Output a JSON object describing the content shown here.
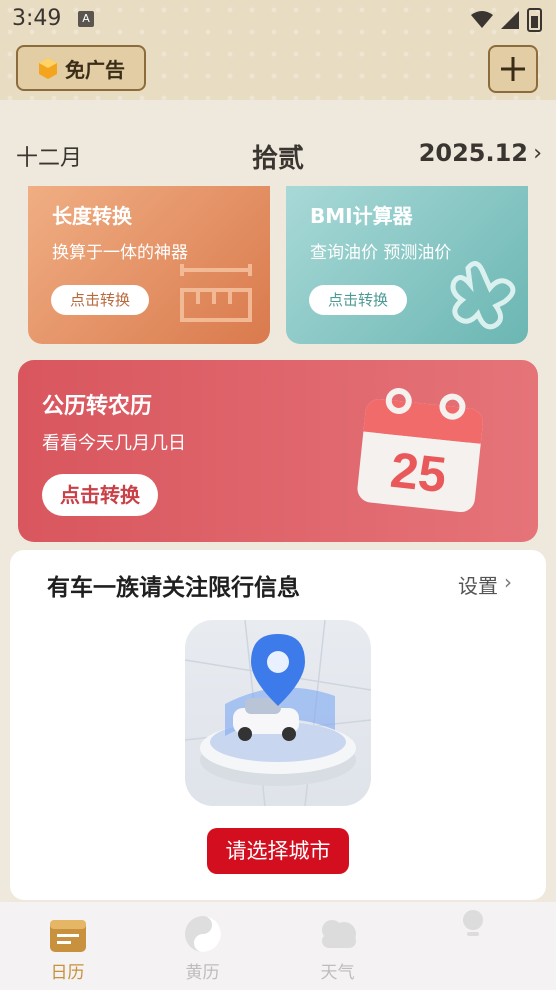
{
  "status_bar": {
    "time": "3:49",
    "notification_letter": "A"
  },
  "header": {
    "ad_free_label": "免广告",
    "add_icon": "plus-icon"
  },
  "date_row": {
    "month": "十二月",
    "day": "拾贰",
    "year_month": "2025.12",
    "chevron": "›"
  },
  "cards": {
    "length": {
      "title": "长度转换",
      "subtitle": "换算于一体的神器",
      "button": "点击转换"
    },
    "bmi": {
      "title": "BMI计算器",
      "subtitle": "查询油价 预测油价",
      "button": "点击转换"
    },
    "lunar": {
      "title": "公历转农历",
      "subtitle": "看看今天几月几日",
      "button": "点击转换",
      "calendar_number": "25"
    }
  },
  "traffic": {
    "title": "有车一族请关注限行信息",
    "settings": "设置",
    "chevron": "›",
    "button": "请选择城市"
  },
  "bottom_nav": {
    "items": [
      {
        "label": "日历",
        "icon": "calendar-icon",
        "active": true
      },
      {
        "label": "黄历",
        "icon": "yin-yang-icon",
        "active": false
      },
      {
        "label": "天气",
        "icon": "cloud-icon",
        "active": false
      },
      {
        "label": "",
        "icon": "profile-icon",
        "active": false
      }
    ]
  },
  "colors": {
    "accent_gold": "#c7913e",
    "lunar_red": "#d9565e",
    "city_button_red": "#d30f1f"
  }
}
